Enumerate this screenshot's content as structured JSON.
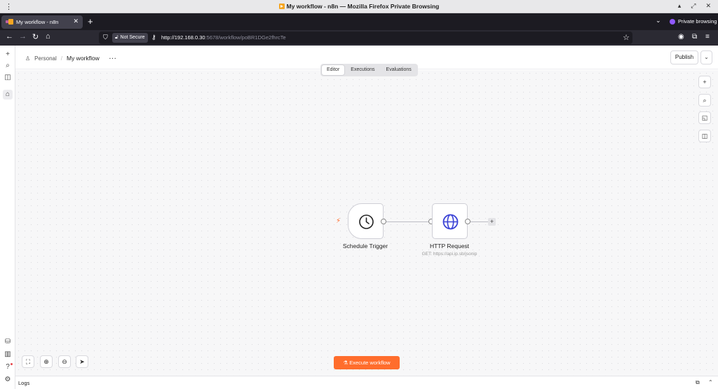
{
  "window": {
    "title": "My workflow - n8n — Mozilla Firefox Private Browsing"
  },
  "browser": {
    "tab_title": "My workflow - n8n",
    "private_label": "Private browsing",
    "security_label": "Not Secure",
    "url_host": "http://192.168.0.30",
    "url_rest": ":5678/workflow/poBR1DGe2fhrcTe"
  },
  "header": {
    "breadcrumb_project": "Personal",
    "breadcrumb_separator": "/",
    "workflow_name": "My workflow",
    "more_label": "···",
    "publish_label": "Publish"
  },
  "tabs": [
    {
      "label": "Editor",
      "active": true
    },
    {
      "label": "Executions",
      "active": false
    },
    {
      "label": "Evaluations",
      "active": false
    }
  ],
  "nodes": {
    "trigger": {
      "name": "Schedule Trigger",
      "icon": "clock-icon"
    },
    "http": {
      "name": "HTTP Request",
      "subtitle": "GET: https://api.ip.sb/jsonip",
      "icon": "globe-icon"
    }
  },
  "canvas": {
    "execute_label": "Execute workflow",
    "execute_icon": "flask-icon"
  },
  "logs": {
    "label": "Logs"
  },
  "colors": {
    "accent": "#ff6d2c",
    "globe": "#3b43d6",
    "browser_dark": "#1c1b22",
    "private_purple": "#9059ff"
  }
}
